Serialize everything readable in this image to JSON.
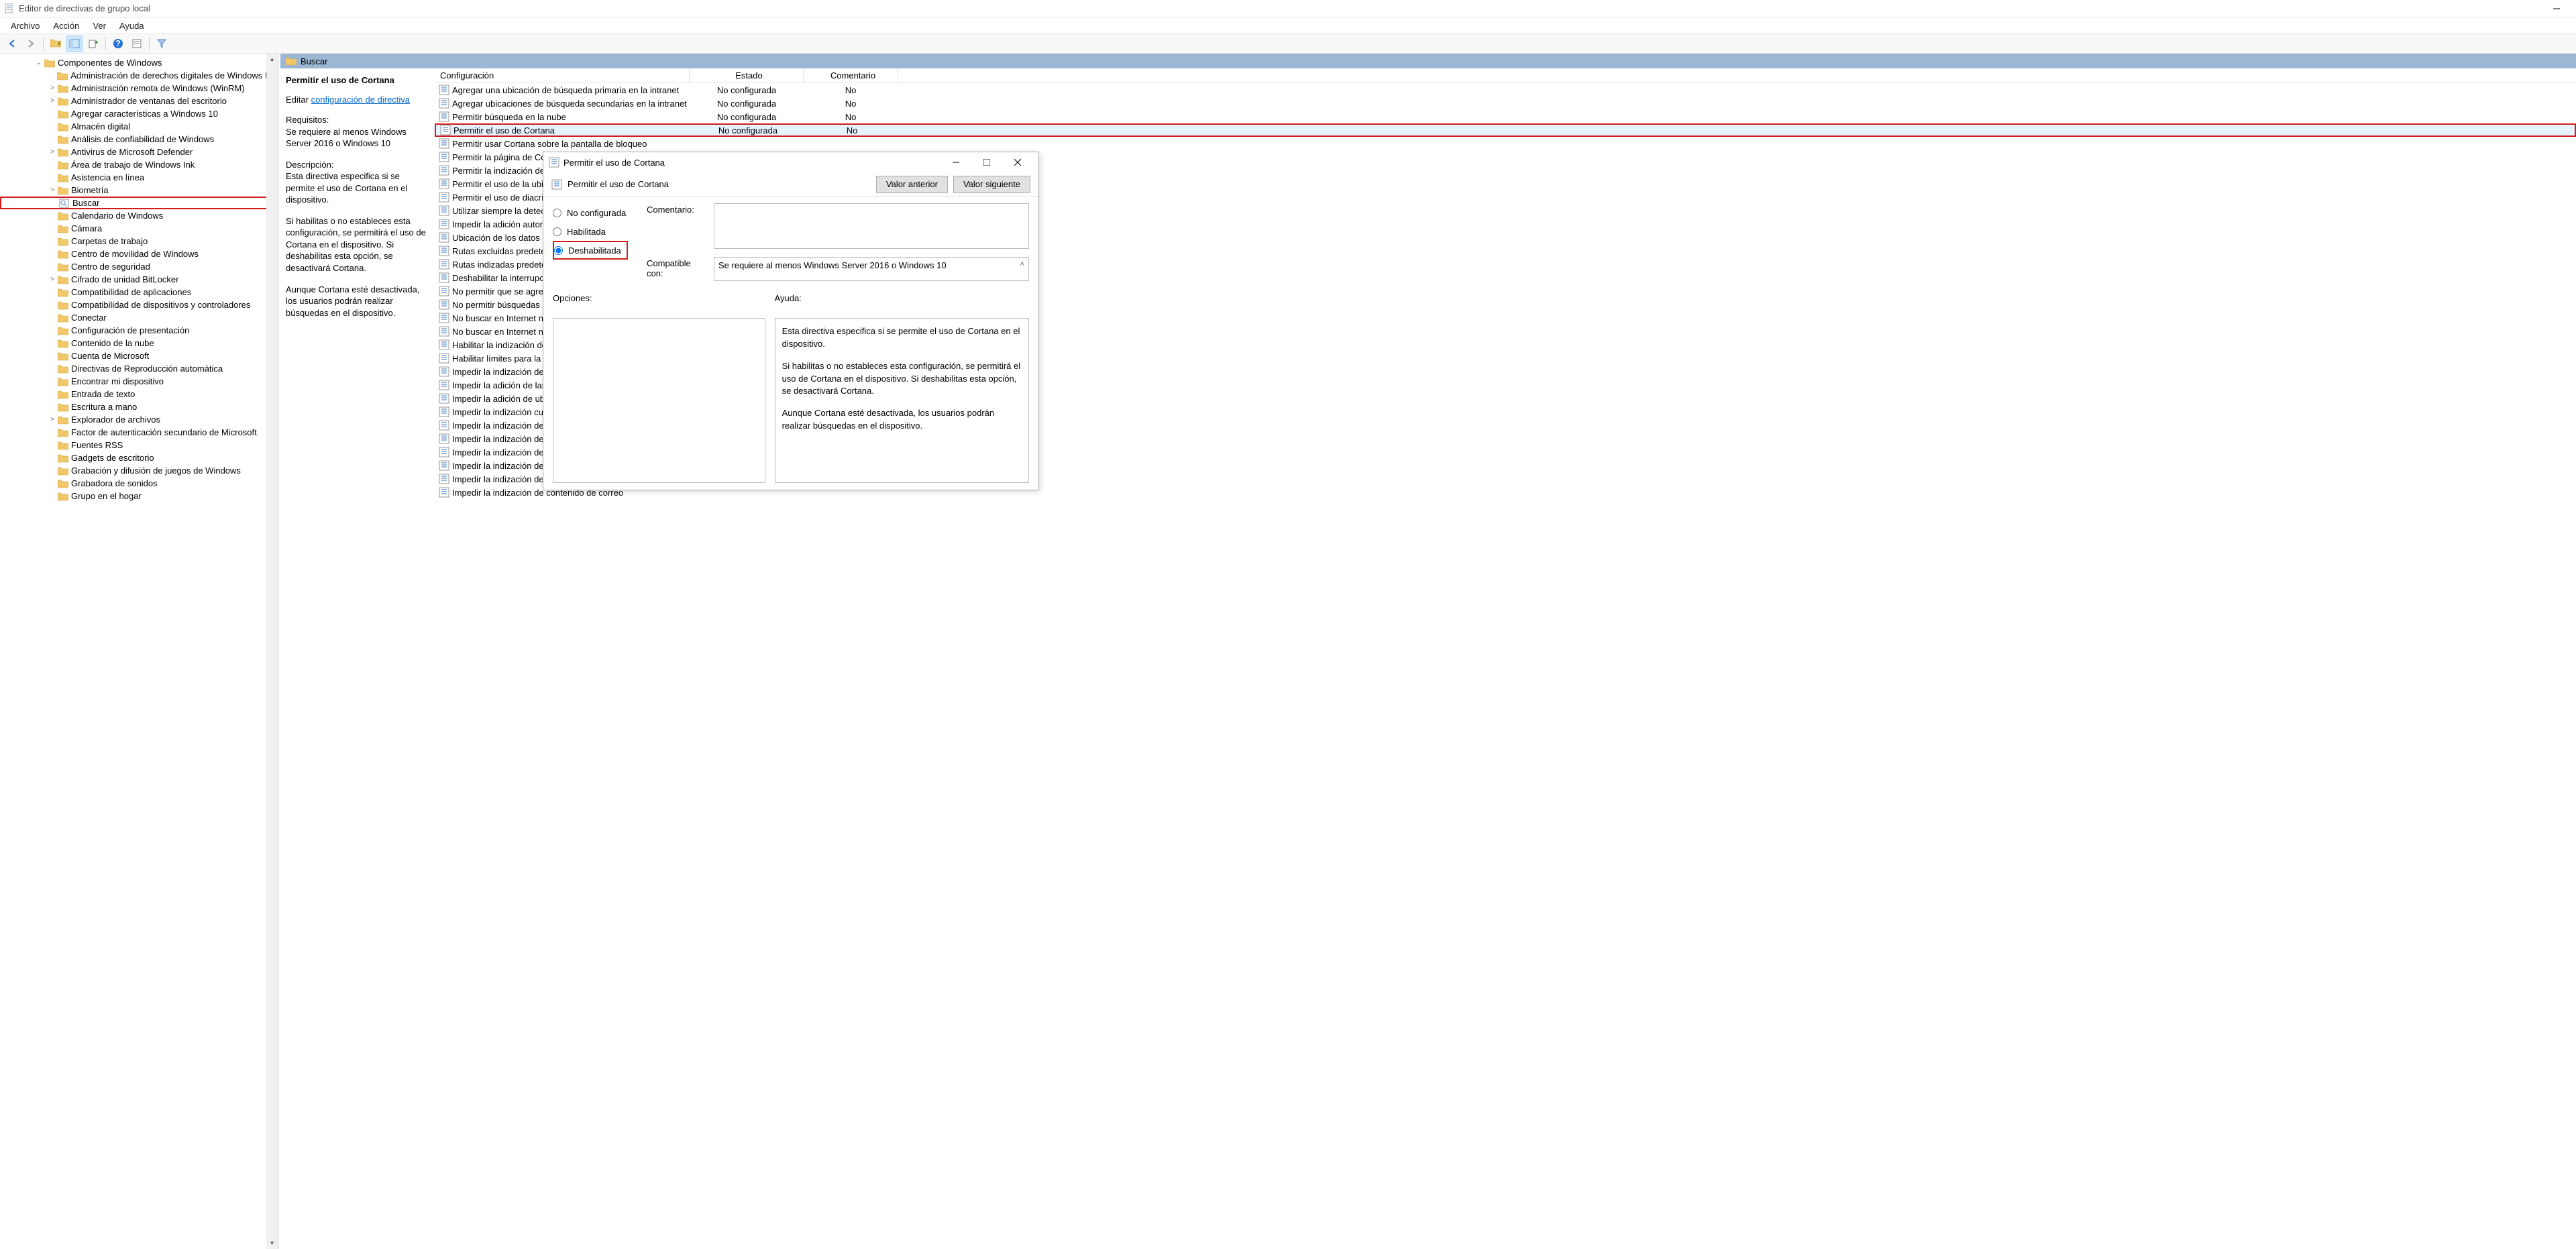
{
  "window": {
    "title": "Editor de directivas de grupo local"
  },
  "menu": [
    "Archivo",
    "Acción",
    "Ver",
    "Ayuda"
  ],
  "tree": {
    "root": {
      "label": "Componentes de Windows"
    },
    "items": [
      {
        "label": "Administración de derechos digitales de Windows Media",
        "expander": ""
      },
      {
        "label": "Administración remota de Windows (WinRM)",
        "expander": ">"
      },
      {
        "label": "Administrador de ventanas del escritorio",
        "expander": ">"
      },
      {
        "label": "Agregar características a Windows 10",
        "expander": ""
      },
      {
        "label": "Almacén digital",
        "expander": ""
      },
      {
        "label": "Análisis de confiabilidad de Windows",
        "expander": ""
      },
      {
        "label": "Antivirus de Microsoft Defender",
        "expander": ">"
      },
      {
        "label": "Área de trabajo de Windows Ink",
        "expander": ""
      },
      {
        "label": "Asistencia en línea",
        "expander": ""
      },
      {
        "label": "Biometría",
        "expander": ">"
      },
      {
        "label": "Buscar",
        "expander": "",
        "highlighted": true,
        "special": true
      },
      {
        "label": "Calendario de Windows",
        "expander": ""
      },
      {
        "label": "Cámara",
        "expander": ""
      },
      {
        "label": "Carpetas de trabajo",
        "expander": ""
      },
      {
        "label": "Centro de movilidad de Windows",
        "expander": ""
      },
      {
        "label": "Centro de seguridad",
        "expander": ""
      },
      {
        "label": "Cifrado de unidad BitLocker",
        "expander": ">"
      },
      {
        "label": "Compatibilidad de aplicaciones",
        "expander": ""
      },
      {
        "label": "Compatibilidad de dispositivos y controladores",
        "expander": ""
      },
      {
        "label": "Conectar",
        "expander": ""
      },
      {
        "label": "Configuración de presentación",
        "expander": ""
      },
      {
        "label": "Contenido de la nube",
        "expander": ""
      },
      {
        "label": "Cuenta de Microsoft",
        "expander": ""
      },
      {
        "label": "Directivas de Reproducción automática",
        "expander": ""
      },
      {
        "label": "Encontrar mi dispositivo",
        "expander": ""
      },
      {
        "label": "Entrada de texto",
        "expander": ""
      },
      {
        "label": "Escritura a mano",
        "expander": ""
      },
      {
        "label": "Explorador de archivos",
        "expander": ">"
      },
      {
        "label": "Factor de autenticación secundario de Microsoft",
        "expander": ""
      },
      {
        "label": "Fuentes RSS",
        "expander": ""
      },
      {
        "label": "Gadgets de escritorio",
        "expander": ""
      },
      {
        "label": "Grabación y difusión de juegos de Windows",
        "expander": ""
      },
      {
        "label": "Grabadora de sonidos",
        "expander": ""
      },
      {
        "label": "Grupo en el hogar",
        "expander": ""
      }
    ]
  },
  "content": {
    "header": "Buscar",
    "detail": {
      "title": "Permitir el uso de Cortana",
      "edit_prefix": "Editar ",
      "edit_link": "configuración de directiva",
      "req_hdr": "Requisitos:",
      "req_body": "Se requiere al menos Windows Server 2016 o Windows 10",
      "desc_hdr": "Descripción:",
      "desc_p1": "Esta directiva especifica si se permite el uso de Cortana en el dispositivo.",
      "desc_p2": "Si habilitas o no estableces esta configuración, se permitirá el uso de Cortana en el dispositivo. Si deshabilitas esta opción, se desactivará Cortana.",
      "desc_p3": "Aunque Cortana esté desactivada, los usuarios podrán realizar búsquedas en el dispositivo."
    },
    "columns": {
      "config": "Configuración",
      "state": "Estado",
      "comment": "Comentario"
    },
    "rows": [
      {
        "label": "Agregar una ubicación de búsqueda primaria en la intranet",
        "state": "No configurada",
        "comment": "No"
      },
      {
        "label": "Agregar ubicaciones de búsqueda secundarias en la intranet",
        "state": "No configurada",
        "comment": "No"
      },
      {
        "label": "Permitir búsqueda en la nube",
        "state": "No configurada",
        "comment": "No"
      },
      {
        "label": "Permitir el uso de Cortana",
        "state": "No configurada",
        "comment": "No",
        "highlighted": true,
        "selected": true
      },
      {
        "label": "Permitir usar Cortana sobre la pantalla de bloqueo",
        "state": "",
        "comment": ""
      },
      {
        "label": "Permitir la página de Cortana en la OOBE",
        "state": "",
        "comment": ""
      },
      {
        "label": "Permitir la indización de archivos cifrados",
        "state": "",
        "comment": ""
      },
      {
        "label": "Permitir el uso de la ubicación por búsqueda y Cortana",
        "state": "",
        "comment": ""
      },
      {
        "label": "Permitir el uso de diacríticos",
        "state": "",
        "comment": ""
      },
      {
        "label": "Utilizar siempre la detección de idioma automática",
        "state": "",
        "comment": ""
      },
      {
        "label": "Impedir la adición automática de ubicaciones compartidas",
        "state": "",
        "comment": ""
      },
      {
        "label": "Ubicación de los datos de indización",
        "state": "",
        "comment": ""
      },
      {
        "label": "Rutas excluidas predeterminadas",
        "state": "",
        "comment": ""
      },
      {
        "label": "Rutas indizadas predeterminadas",
        "state": "",
        "comment": ""
      },
      {
        "label": "Deshabilitar la interrupción del indizador",
        "state": "",
        "comment": ""
      },
      {
        "label": "No permitir que se agreguen ubicaciones",
        "state": "",
        "comment": ""
      },
      {
        "label": "No permitir búsquedas en la Web",
        "state": "",
        "comment": ""
      },
      {
        "label": "No buscar en Internet ni mostrar resultados de Internet",
        "state": "",
        "comment": ""
      },
      {
        "label": "No buscar en Internet ni mostrar resultados de Internet",
        "state": "",
        "comment": ""
      },
      {
        "label": "Habilitar la indización de archivos sin conexión",
        "state": "",
        "comment": ""
      },
      {
        "label": "Habilitar límites para la indización",
        "state": "",
        "comment": ""
      },
      {
        "label": "Impedir la indización de ciertos tipos de archivo",
        "state": "",
        "comment": ""
      },
      {
        "label": "Impedir la adición de las rutas predeterminadas",
        "state": "",
        "comment": ""
      },
      {
        "label": "Impedir la adición de ubicaciones personalizadas",
        "state": "",
        "comment": ""
      },
      {
        "label": "Impedir la indización cuando se ejecuta con batería",
        "state": "",
        "comment": ""
      },
      {
        "label": "Impedir la indización de carpetas sin conexión",
        "state": "",
        "comment": ""
      },
      {
        "label": "Impedir la indización de datos adjuntos",
        "state": "",
        "comment": ""
      },
      {
        "label": "Impedir la indización de Outlook",
        "state": "",
        "comment": ""
      },
      {
        "label": "Impedir la indización de archivos en la caché",
        "state": "",
        "comment": ""
      },
      {
        "label": "Impedir la indización de ciertas rutas",
        "state": "",
        "comment": ""
      },
      {
        "label": "Impedir la indización de contenido de correo",
        "state": "",
        "comment": ""
      }
    ]
  },
  "dialog": {
    "title": "Permitir el uso de Cortana",
    "subtitle": "Permitir el uso de Cortana",
    "btn_prev": "Valor anterior",
    "btn_next": "Valor siguiente",
    "radio_unconfig": "No configurada",
    "radio_enabled": "Habilitada",
    "radio_disabled": "Deshabilitada",
    "lbl_comment": "Comentario:",
    "lbl_compat": "Compatible con:",
    "compat_text": "Se requiere al menos Windows Server 2016 o Windows 10",
    "lbl_options": "Opciones:",
    "lbl_help": "Ayuda:",
    "help_p1": "Esta directiva especifica si se permite el uso de Cortana en el dispositivo.",
    "help_p2": "Si habilitas o no estableces esta configuración, se permitirá el uso de Cortana en el dispositivo. Si deshabilitas esta opción, se desactivará Cortana.",
    "help_p3": "Aunque Cortana esté desactivada, los usuarios podrán realizar búsquedas en el dispositivo."
  }
}
